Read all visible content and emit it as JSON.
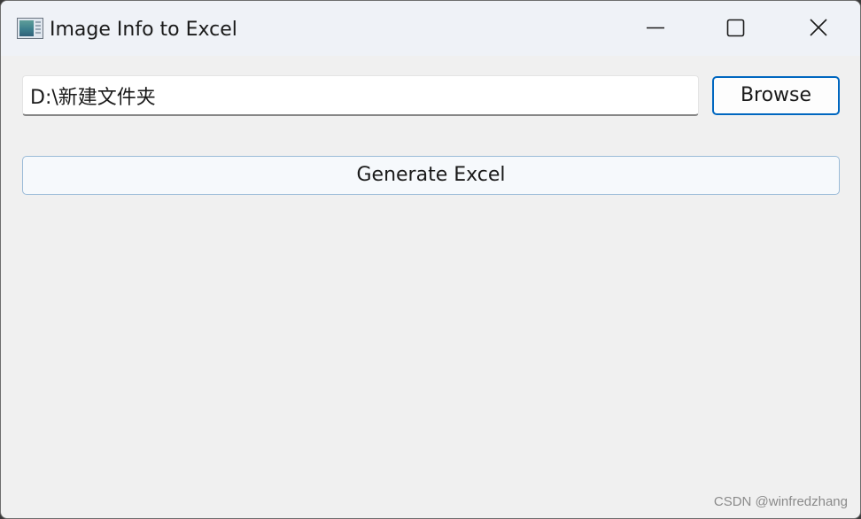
{
  "window": {
    "title": "Image Info to Excel",
    "icon": "app-window-icon"
  },
  "window_controls": {
    "minimize_icon": "minimize-icon",
    "maximize_icon": "maximize-icon",
    "close_icon": "close-icon"
  },
  "form": {
    "path_value": "D:\\新建文件夹",
    "browse_label": "Browse",
    "generate_label": "Generate Excel"
  },
  "watermark": {
    "text": "CSDN @winfredzhang"
  },
  "colors": {
    "accent": "#0067c0",
    "window_bg": "#f0f0f0",
    "titlebar_bg": "#eff2f7"
  }
}
